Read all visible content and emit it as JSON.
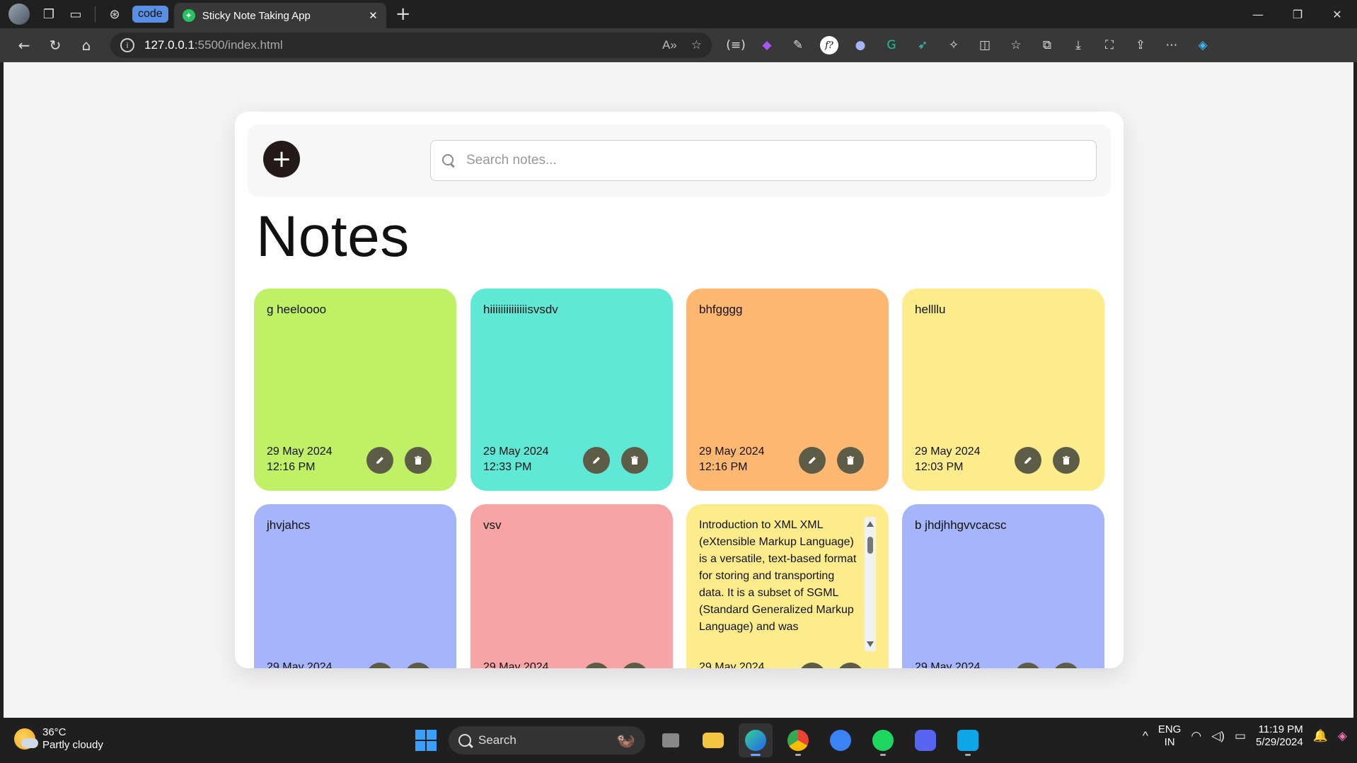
{
  "browser": {
    "tab_group_label": "code",
    "tab_title": "Sticky Note Taking App",
    "url_host": "127.0.0.1",
    "url_path": ":5500/index.html",
    "ext_fx_label": "f?"
  },
  "app": {
    "add_button_symbol": "+",
    "search_placeholder": "Search notes...",
    "title": "Notes",
    "notes": [
      {
        "text": "g heeloooo",
        "date": "29 May 2024",
        "time": "12:16 PM",
        "color": "#c0f065"
      },
      {
        "text": "hiiiiiiiiiiiiiisvsdv",
        "date": "29 May 2024",
        "time": "12:33 PM",
        "color": "#5fe8d6"
      },
      {
        "text": "bhfgggg",
        "date": "29 May 2024",
        "time": "12:16 PM",
        "color": "#feb872"
      },
      {
        "text": "hellllu",
        "date": "29 May 2024",
        "time": "12:03 PM",
        "color": "#fdec8c"
      },
      {
        "text": "jhvjahcs",
        "date": "29 May 2024",
        "time": "",
        "color": "#a5b4fb"
      },
      {
        "text": "vsv",
        "date": "29 May 2024",
        "time": "",
        "color": "#f9a4a4"
      },
      {
        "text": "Introduction to XML XML (eXtensible Markup Language) is a versatile, text-based format for storing and transporting data. It is a subset of SGML (Standard Generalized Markup Language) and was",
        "date": "29 May 2024",
        "time": "",
        "color": "#fdec8c"
      },
      {
        "text": "b jhdjhhgvvcacsc",
        "date": "29 May 2024",
        "time": "",
        "color": "#a5b4fb"
      }
    ]
  },
  "taskbar": {
    "temperature": "36°C",
    "weather": "Partly cloudy",
    "search_label": "Search",
    "lang_top": "ENG",
    "lang_bottom": "IN",
    "time": "11:19 PM",
    "date": "5/29/2024"
  }
}
